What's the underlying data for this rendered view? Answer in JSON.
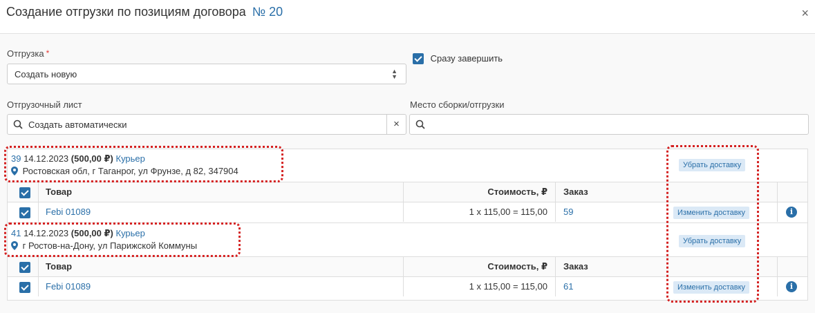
{
  "header": {
    "title": "Создание отгрузки по позициям договора",
    "contract_number": "№ 20",
    "close_label": "×"
  },
  "form": {
    "shipment_label": "Отгрузка",
    "required_mark": "*",
    "shipment_value": "Создать новую",
    "complete_checkbox_label": "Сразу завершить",
    "shipping_sheet_label": "Отгрузочный лист",
    "shipping_sheet_value": "Создать автоматически",
    "clear_label": "×",
    "place_label": "Место сборки/отгрузки",
    "place_value": ""
  },
  "columns": {
    "item": "Товар",
    "cost": "Стоимость, ₽",
    "order": "Заказ"
  },
  "groups": [
    {
      "id": "39",
      "date": "14.12.2023",
      "amount": "(500,00 ₽)",
      "method": "Курьер",
      "address": "Ростовская обл, г Таганрог, ул Фрунзе, д 82, 347904",
      "remove_label": "Убрать доставку",
      "rows": [
        {
          "item": "Febi 01089",
          "cost": "1 x 115,00 = 115,00",
          "order": "59",
          "change_label": "Изменить доставку",
          "info": "i"
        }
      ]
    },
    {
      "id": "41",
      "date": "14.12.2023",
      "amount": "(500,00 ₽)",
      "method": "Курьер",
      "address": "г Ростов-на-Дону, ул Парижской Коммуны",
      "remove_label": "Убрать доставку",
      "rows": [
        {
          "item": "Febi 01089",
          "cost": "1 x 115,00 = 115,00",
          "order": "61",
          "change_label": "Изменить доставку",
          "info": "i"
        }
      ]
    }
  ],
  "colors": {
    "accent": "#2a6fa8",
    "highlight": "#d42020",
    "chip_bg": "#dbe9f6"
  }
}
